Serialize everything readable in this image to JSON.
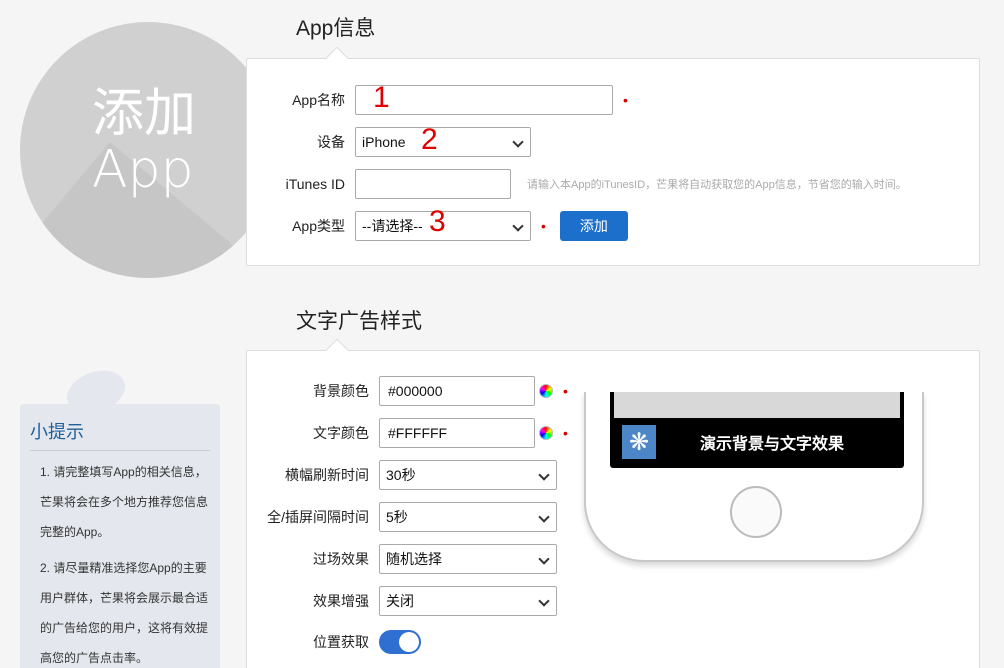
{
  "hero": {
    "title_line1": "添加",
    "title_line2": "App"
  },
  "tip": {
    "title": "小提示",
    "items": [
      "1. 请完整填写App的相关信息，芒果将会在多个地方推荐您信息完整的App。",
      "2. 请尽量精准选择您App的主要用户群体，芒果将会展示最合适的广告给您的用户，这将有效提高您的广告点击率。"
    ]
  },
  "app_info": {
    "section_title": "App信息",
    "name_label": "App名称",
    "name_value": "",
    "device_label": "设备",
    "device_value": "iPhone",
    "itunes_label": "iTunes ID",
    "itunes_value": "",
    "itunes_hint": "请输入本App的iTunesID，芒果将自动获取您的App信息，节省您的输入时间。",
    "type_label": "App类型",
    "type_value": "--请选择--",
    "add_button": "添加",
    "required_mark": "•",
    "annotations": [
      "1",
      "2",
      "3"
    ]
  },
  "text_ad": {
    "section_title": "文字广告样式",
    "bg_color_label": "背景颜色",
    "bg_color_value": "#000000",
    "text_color_label": "文字颜色",
    "text_color_value": "#FFFFFF",
    "refresh_label": "横幅刷新时间",
    "refresh_value": "30秒",
    "interval_label": "全/插屏间隔时间",
    "interval_value": "5秒",
    "transition_label": "过场效果",
    "transition_value": "随机选择",
    "enhance_label": "效果增强",
    "enhance_value": "关闭",
    "location_label": "位置获取",
    "location_on": true,
    "preview_text": "演示背景与文字效果",
    "preview_icon": "gear-flower-icon"
  },
  "colors": {
    "accent": "#1c6fcb",
    "required": "#d40000",
    "annotation": "#e00000"
  }
}
